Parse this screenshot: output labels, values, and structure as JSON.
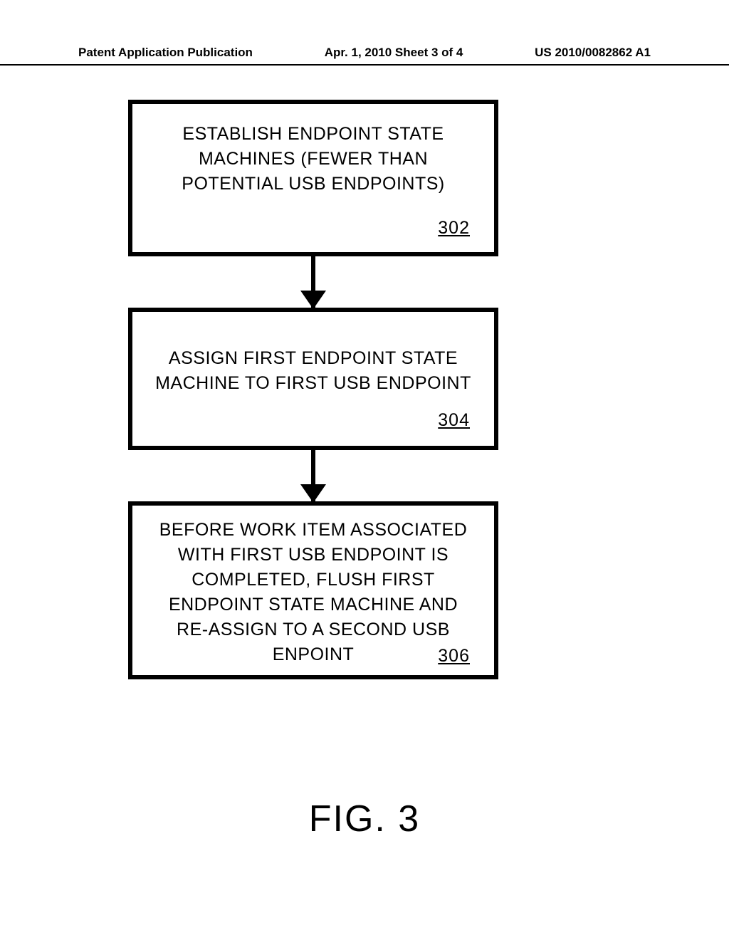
{
  "header": {
    "left": "Patent Application Publication",
    "mid": "Apr. 1, 2010   Sheet 3 of 4",
    "right": "US 2010/0082862 A1"
  },
  "boxes": {
    "b1": {
      "text": "ESTABLISH ENDPOINT STATE MACHINES (FEWER THAN POTENTIAL USB ENDPOINTS)",
      "num": "302"
    },
    "b2": {
      "text": "ASSIGN FIRST ENDPOINT STATE MACHINE TO FIRST USB ENDPOINT",
      "num": "304"
    },
    "b3": {
      "text": "BEFORE WORK ITEM ASSOCIATED WITH FIRST USB ENDPOINT IS COMPLETED, FLUSH FIRST ENDPOINT STATE MACHINE AND RE-ASSIGN TO A SECOND USB ENPOINT",
      "num": "306"
    }
  },
  "figure_label": "FIG. 3"
}
